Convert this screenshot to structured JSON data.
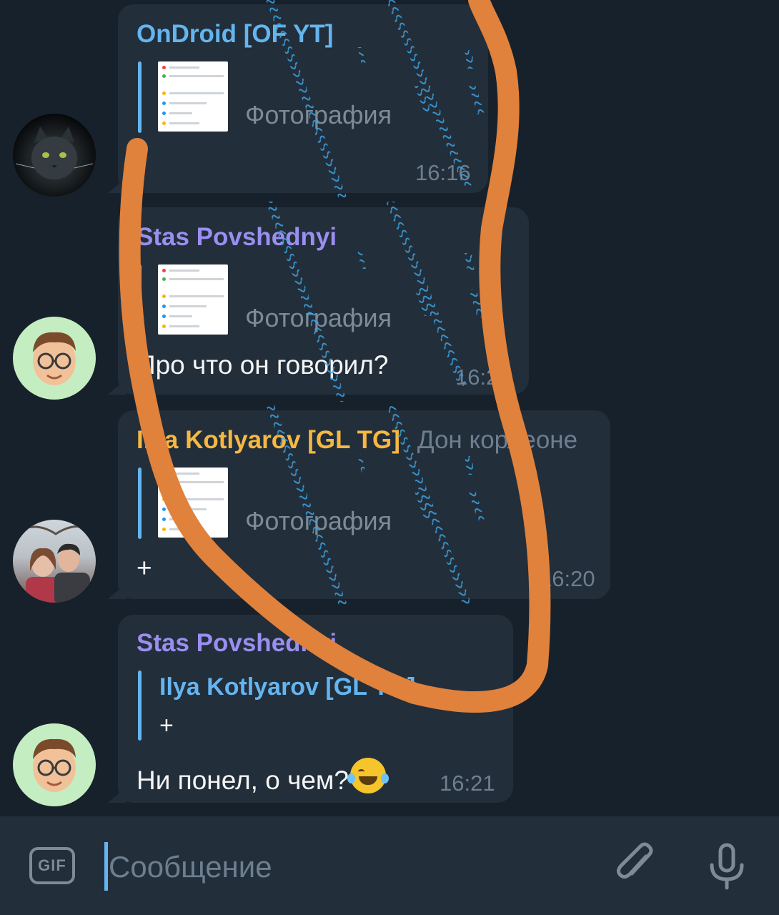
{
  "colors": {
    "background": "#17212b",
    "bubble": "#222e3a",
    "name_blue": "#64b5ef",
    "name_purple": "#9a8ef0",
    "name_orange": "#f6b842",
    "muted": "#6d7f8f",
    "annotation_orange": "#e0813c"
  },
  "messages": [
    {
      "sender": "OnDroid [OF YT]",
      "media_label": "Фотография",
      "text": "-",
      "time": "16:16",
      "avatar": "gray-cat-avatar"
    },
    {
      "sender": "Stas Povshednyi",
      "media_label": "Фотография",
      "text": "Про что он говорил?",
      "time": "16:20",
      "avatar": "memoji-avatar"
    },
    {
      "sender": "Ilya Kotlyarov [GL TG]",
      "admin_title": "Дон корлеоне",
      "media_label": "Фотография",
      "text": "+",
      "time": "16:20",
      "avatar": "couple-photo-avatar"
    },
    {
      "sender": "Stas Povshednyi",
      "reply_to_name": "Ilya Kotlyarov [GL TG]",
      "reply_to_text": "+",
      "text": "Ни понел, о чем?",
      "emoji": "face-with-tears-of-joy",
      "time": "16:21",
      "avatar": "memoji-avatar"
    }
  ],
  "input": {
    "gif_label": "GIF",
    "placeholder": "Сообщение",
    "attach_icon": "paperclip-icon",
    "mic_icon": "microphone-icon"
  }
}
